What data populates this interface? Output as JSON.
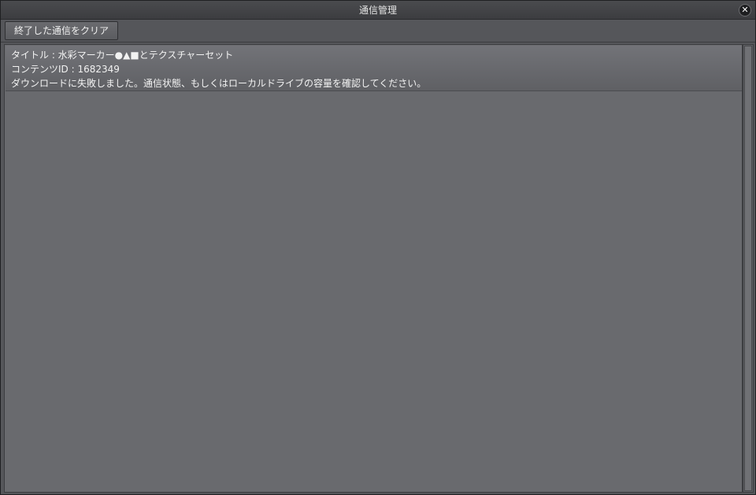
{
  "window": {
    "title": "通信管理",
    "close_label": "✕"
  },
  "toolbar": {
    "clear_label": "終了した通信をクリア"
  },
  "list": {
    "items": [
      {
        "title_line": "タイトル : 水彩マーカー●▲■とテクスチャーセット",
        "content_id_line": "コンテンツID : 1682349",
        "status_line": "ダウンロードに失敗しました。通信状態、もしくはローカルドライブの容量を確認してください。"
      }
    ]
  }
}
